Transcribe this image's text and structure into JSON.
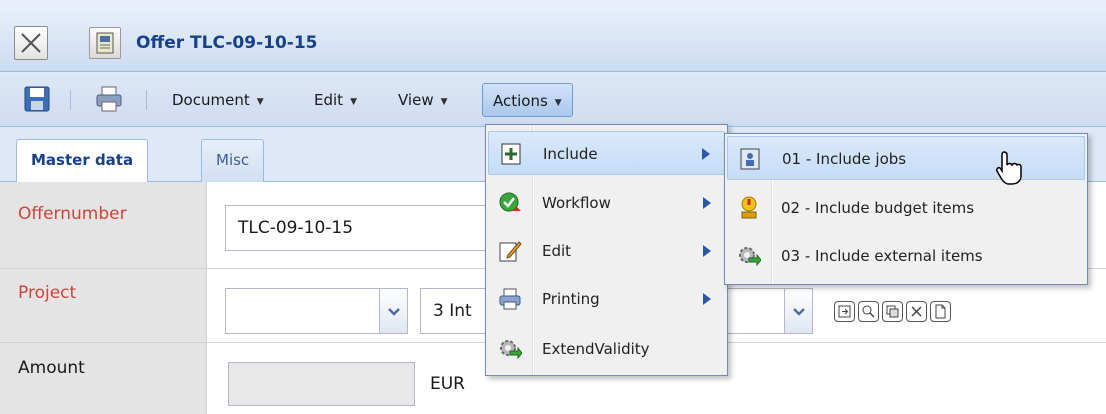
{
  "window": {
    "title": "Offer TLC-09-10-15",
    "icons": {
      "close": "close-x-icon",
      "document": "document-icon"
    }
  },
  "toolbar": {
    "icons": [
      "save-icon",
      "print-icon"
    ],
    "menus": [
      {
        "label": "Document"
      },
      {
        "label": "Edit"
      },
      {
        "label": "View"
      },
      {
        "label": "Actions",
        "active": true
      }
    ]
  },
  "tabs": [
    {
      "label": "Master data",
      "active": true
    },
    {
      "label": "Misc",
      "active": false
    }
  ],
  "form": {
    "offernumber": {
      "label": "Offernumber",
      "value": "TLC-09-10-15"
    },
    "project": {
      "label": "Project",
      "value": "",
      "value2": "3 Int"
    },
    "amount": {
      "label": "Amount",
      "value": "",
      "unit": "EUR"
    }
  },
  "actions_menu": {
    "items": [
      {
        "label": "Include",
        "icon": "include-plus-icon",
        "submenu": true,
        "hover": true
      },
      {
        "label": "Workflow",
        "icon": "workflow-icon",
        "submenu": true
      },
      {
        "label": "Edit",
        "icon": "edit-pencil-icon",
        "submenu": true
      },
      {
        "label": "Printing",
        "icon": "printer-icon",
        "submenu": true
      },
      {
        "label": "ExtendValidity",
        "icon": "gear-arrow-icon",
        "submenu": false
      }
    ]
  },
  "include_submenu": {
    "items": [
      {
        "label": "01 - Include jobs",
        "icon": "jobs-icon",
        "hover": true
      },
      {
        "label": "02 - Include budget items",
        "icon": "budget-icon"
      },
      {
        "label": "03 - Include external items",
        "icon": "gear-arrow-icon"
      }
    ]
  },
  "colors": {
    "title_text": "#15428b",
    "required_label": "#d04437",
    "menu_hover": "#c5dcf7"
  }
}
